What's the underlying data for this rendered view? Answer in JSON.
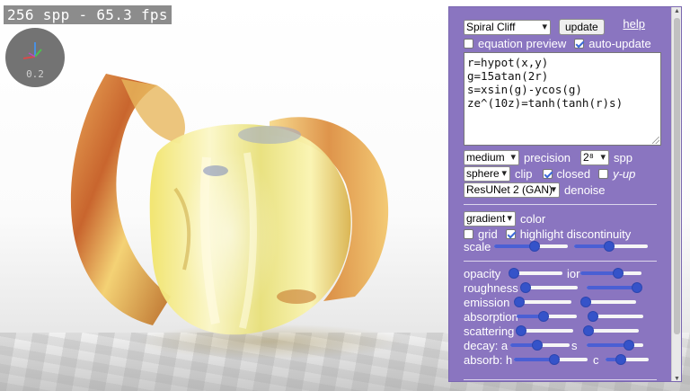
{
  "viewport": {
    "stats": "256 spp - 65.3 fps",
    "axes_label": "0.2"
  },
  "panel": {
    "preset": "Spiral Cliff",
    "update_label": "update",
    "help_label": "help",
    "equation_preview_label": "equation preview",
    "equation_preview_checked": false,
    "auto_update_label": "auto-update",
    "auto_update_checked": true,
    "equations": [
      "r=hypot(x,y)",
      "g=15atan(2r)",
      "s=xsin(g)-ycos(g)",
      "ze^(10z)=tanh(tanh(r)s)"
    ],
    "precision_value": "medium",
    "precision_label": "precision",
    "spp_value": "2⁸",
    "spp_label": "spp",
    "clip_value": "sphere",
    "clip_label": "clip",
    "closed_label": "closed",
    "closed_checked": true,
    "yup_label": "y-up",
    "yup_checked": false,
    "denoise_value": "ResUNet 2 (GAN)",
    "denoise_label": "denoise",
    "color_value": "gradient",
    "color_label": "color",
    "grid_label": "grid",
    "grid_checked": false,
    "highlight_label": "highlight discontinuity",
    "highlight_checked": true,
    "scale_label": "scale",
    "scale_values": [
      0.55,
      0.48
    ],
    "sliders": [
      {
        "label": "opacity",
        "value": 0.0,
        "label2": "ior",
        "value2": 0.62
      },
      {
        "label": "roughness",
        "value": 0.0,
        "label2": "",
        "value2": 0.95
      },
      {
        "label": "emission",
        "value": 0.0,
        "label2": "",
        "value2": 0.0
      },
      {
        "label": "absorption",
        "value": 0.45,
        "label2": "",
        "value2": 0.0
      },
      {
        "label": "scattering",
        "value": 0.0,
        "label2": "",
        "value2": 0.06
      },
      {
        "label": "decay: a",
        "value": 0.45,
        "label2": "s",
        "value2": 0.75
      },
      {
        "label": "absorb: h",
        "value": 0.55,
        "label2": "c",
        "value2": 0.35
      }
    ]
  }
}
